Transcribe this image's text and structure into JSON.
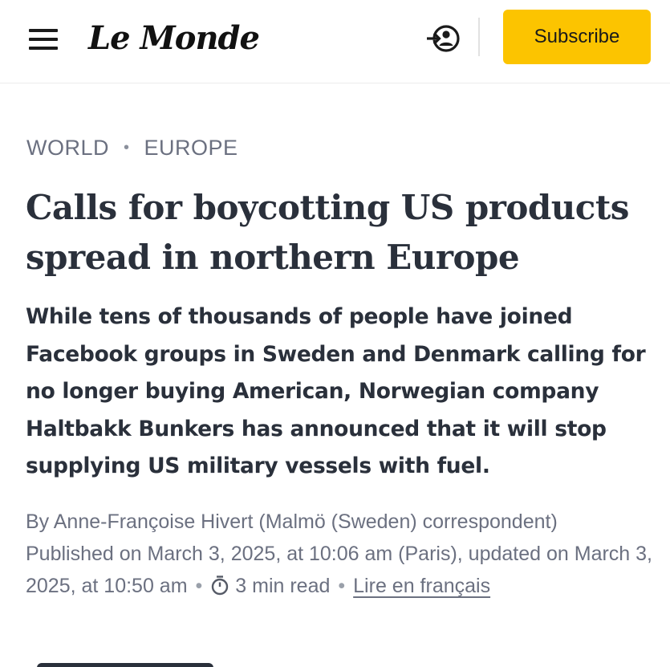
{
  "header": {
    "logo_text": "Le Monde",
    "subscribe_label": "Subscribe"
  },
  "breadcrumb": {
    "section": "WORLD",
    "separator": "•",
    "subsection": "EUROPE"
  },
  "article": {
    "headline": "Calls for boycotting US products spread in northern Europe",
    "dek": "While tens of thousands of people have joined Facebook groups in Sweden and Denmark calling for no longer buying American, Norwegian company Haltbakk Bunkers has announced that it will stop supplying US military vessels with fuel.",
    "byline": "By Anne-Françoise Hivert (Malmö (Sweden) correspondent)",
    "published_text": "Published on March 3, 2025, at 10:06 am (Paris), updated on March 3, 2025, at 10:50 am",
    "read_time": "3 min read",
    "french_link": "Lire en français"
  },
  "colors": {
    "accent": "#fcc400",
    "text": "#2a303b",
    "muted": "#6b7080"
  },
  "icons": {
    "menu": "hamburger-menu-icon",
    "login": "login-icon",
    "clock": "clock-icon"
  }
}
